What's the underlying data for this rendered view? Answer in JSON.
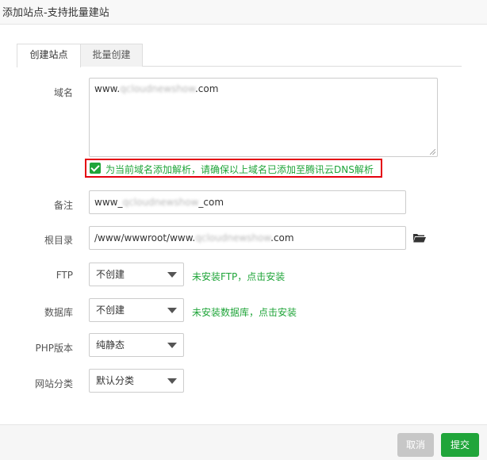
{
  "window": {
    "title": "添加站点-支持批量建站"
  },
  "tabs": [
    {
      "label": "创建站点",
      "active": true
    },
    {
      "label": "批量创建",
      "active": false
    }
  ],
  "form": {
    "domain": {
      "label": "域名",
      "value_prefix": "www.",
      "value_blurred": "qcloudnewshow",
      "value_suffix": ".com"
    },
    "dns_option": {
      "checked": true,
      "label": "为当前域名添加解析，请确保以上域名已添加至腾讯云DNS解析"
    },
    "remark": {
      "label": "备注",
      "value_prefix": "www_",
      "value_blurred": "qcloudnewshow",
      "value_suffix": "_com"
    },
    "root_dir": {
      "label": "根目录",
      "value_prefix": "/www/wwwroot/www.",
      "value_blurred": "qcloudnewshow",
      "value_suffix": ".com",
      "icon": "folder-open-icon"
    },
    "ftp": {
      "label": "FTP",
      "selected": "不创建",
      "hint": "未安装FTP，点击安装"
    },
    "database": {
      "label": "数据库",
      "selected": "不创建",
      "hint": "未安装数据库，点击安装"
    },
    "php_version": {
      "label": "PHP版本",
      "selected": "纯静态"
    },
    "site_category": {
      "label": "网站分类",
      "selected": "默认分类"
    }
  },
  "footer": {
    "cancel_label": "取消",
    "submit_label": "提交"
  },
  "colors": {
    "accent_green": "#20a53a",
    "highlight_red": "#e4000f",
    "disabled_gray": "#c7c7c7"
  }
}
